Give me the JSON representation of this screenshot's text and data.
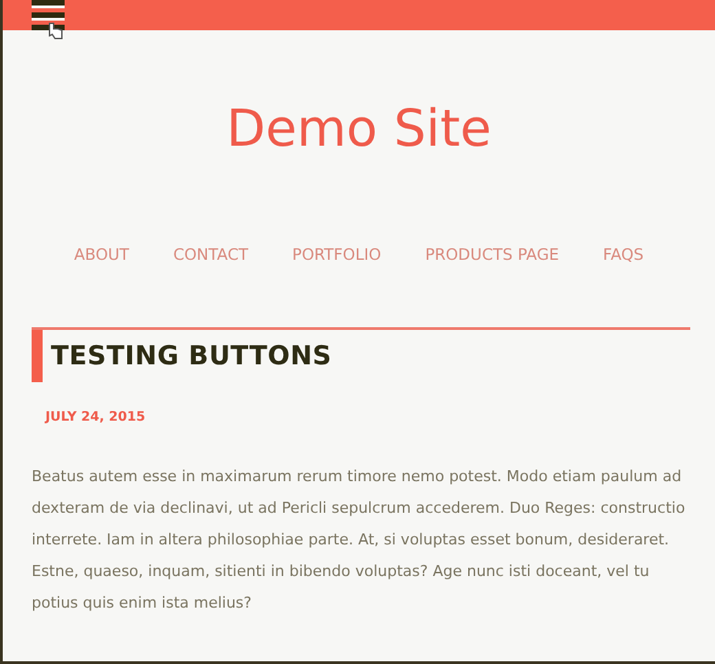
{
  "site_title": "Demo Site",
  "nav": [
    {
      "label": "ABOUT"
    },
    {
      "label": "CONTACT"
    },
    {
      "label": "PORTFOLIO"
    },
    {
      "label": "PRODUCTS PAGE"
    },
    {
      "label": "FAQS"
    }
  ],
  "post": {
    "title": "TESTING BUTTONS",
    "date": "JULY 24, 2015",
    "body": "Beatus autem esse in maximarum rerum timore nemo potest. Modo etiam paulum ad dexteram de via declinavi, ut ad Pericli sepulcrum accederem. Duo Reges: constructio interrete. Iam in altera philosophiae parte. At, si voluptas esset bonum, desideraret. Estne, quaeso, inquam, sitienti in bibendo voluptas? Age nunc isti doceant, vel tu potius quis enim ista melius?"
  }
}
